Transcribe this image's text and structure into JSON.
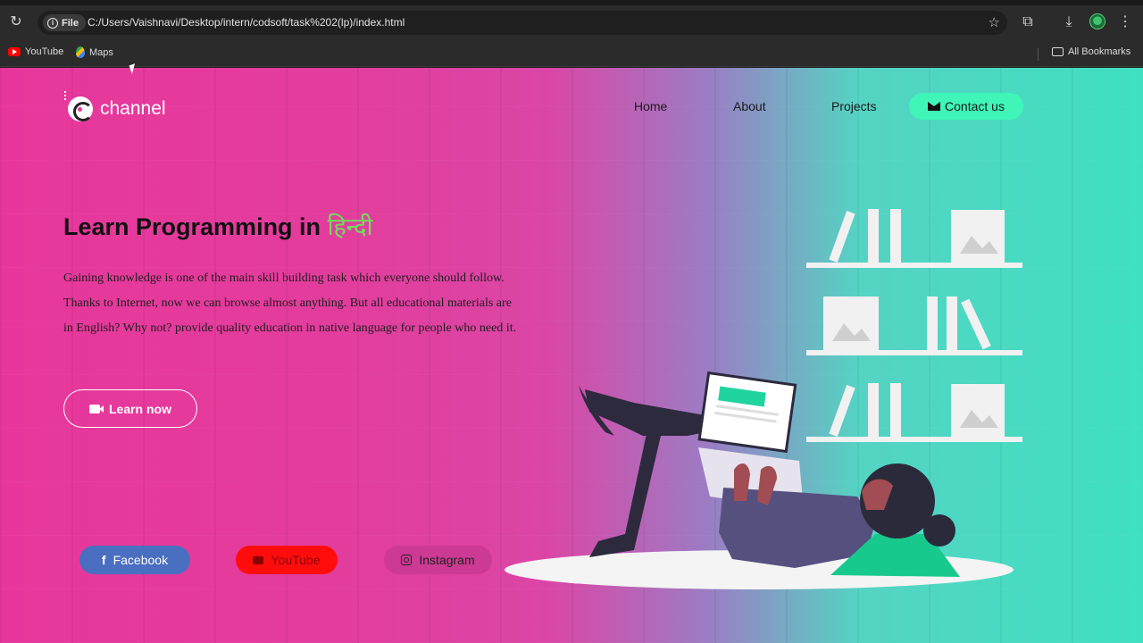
{
  "browser": {
    "chip_label": "File",
    "url": "C:/Users/Vaishnavi/Desktop/intern/codsoft/task%202(lp)/index.html",
    "bookmarks": [
      {
        "label": "YouTube",
        "icon": "youtube-icon"
      },
      {
        "label": "Maps",
        "icon": "maps-icon"
      }
    ],
    "all_bookmarks_label": "All Bookmarks"
  },
  "site": {
    "logo_text": "channel",
    "nav": {
      "home": "Home",
      "about": "About",
      "projects": "Projects",
      "contact": "Contact us"
    },
    "hero": {
      "title": "Learn Programming in ",
      "title_hindi": "हिन्दी",
      "paragraph": "Gaining knowledge is one of the main skill building task which everyone should follow. Thanks to Internet, now we can browse almost anything. But all educational materials are in English? Why not? provide quality education in native language for people who need it.",
      "cta_label": "Learn now"
    },
    "social": {
      "facebook": "Facebook",
      "youtube": "YouTube",
      "instagram": "Instagram"
    }
  },
  "colors": {
    "accent_green": "#3ff5b7",
    "hindi_green": "#6fdc5c",
    "pink": "#e8379c",
    "facebook_blue": "#4a6ec0",
    "youtube_red": "#ff0d0d"
  }
}
